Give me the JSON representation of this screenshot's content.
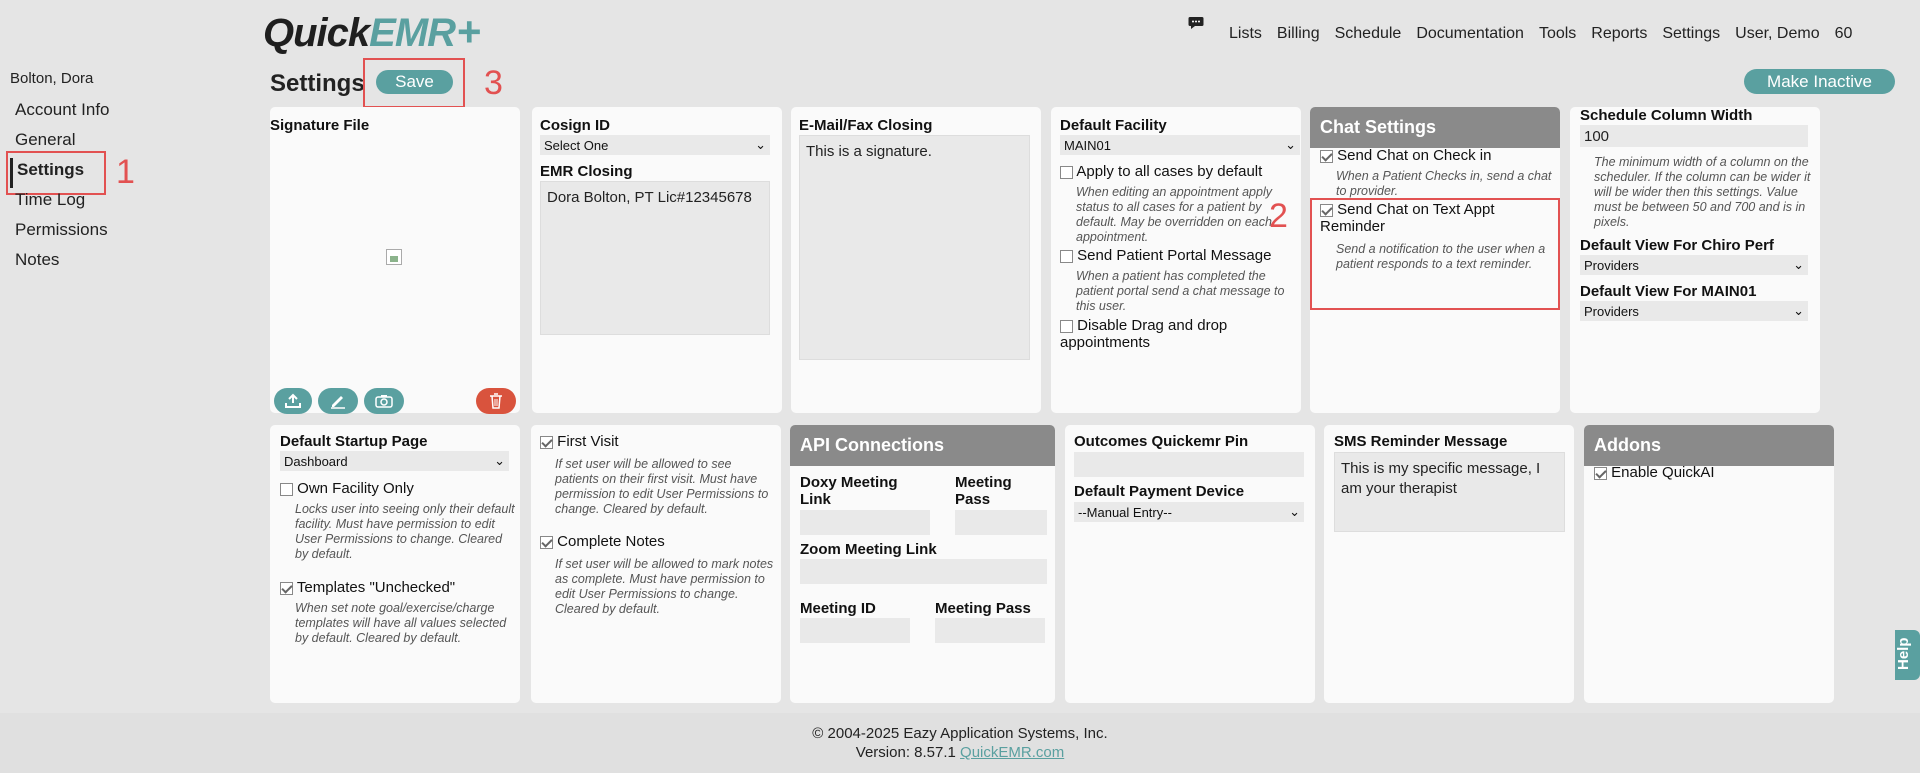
{
  "header": {
    "logo_quick": "Quick",
    "logo_emr": "EMR",
    "logo_plus": "+",
    "nav": [
      "Lists",
      "Billing",
      "Schedule",
      "Documentation",
      "Tools",
      "Reports",
      "Settings",
      "User, Demo",
      "60"
    ]
  },
  "sidebar": {
    "patient_name": "Bolton, Dora",
    "items": [
      "Account Info",
      "General",
      "Settings",
      "Time Log",
      "Permissions",
      "Notes"
    ]
  },
  "annotations": {
    "one": "1",
    "two": "2",
    "three": "3"
  },
  "page": {
    "title": "Settings",
    "save_label": "Save",
    "make_inactive_label": "Make Inactive"
  },
  "signature": {
    "label": "Signature File"
  },
  "cosign": {
    "label": "Cosign ID",
    "selected": "Select One",
    "emr_closing_label": "EMR Closing",
    "emr_closing_value": "Dora Bolton, PT Lic#12345678"
  },
  "email": {
    "label": "E-Mail/Fax Closing",
    "value": "This is a signature."
  },
  "facility": {
    "label": "Default Facility",
    "selected": "MAIN01",
    "apply_label": "Apply to all cases by default",
    "apply_note": "When editing an appointment apply status to all cases for a patient by default. May be overridden on each appointment.",
    "portal_label": "Send Patient Portal Message",
    "portal_note": "When a patient has completed the patient portal send a chat message to this user.",
    "drag_label": "Disable Drag and drop appointments"
  },
  "chat": {
    "heading": "Chat Settings",
    "checkin_label": "Send Chat on Check in",
    "checkin_note": "When a Patient Checks in, send a chat to provider.",
    "reminder_label": "Send Chat on Text Appt Reminder",
    "reminder_note": "Send a notification to the user when a patient responds to a text reminder."
  },
  "schedule": {
    "width_label": "Schedule Column Width",
    "width_value": "100",
    "width_note": "The minimum width of a column on the scheduler. If the column can be wider it will be wider then this settings. Value must be between 50 and 700 and is in pixels.",
    "chiro_label": "Default View For Chiro Perf",
    "chiro_selected": "Providers",
    "main_label": "Default View For MAIN01",
    "main_selected": "Providers"
  },
  "startup": {
    "label": "Default Startup Page",
    "selected": "Dashboard",
    "own_label": "Own Facility Only",
    "own_note": "Locks user into seeing only their default facility. Must have permission to edit User Permissions to change. Cleared by default.",
    "templates_label": "Templates \"Unchecked\"",
    "templates_note": "When set note goal/exercise/charge templates will have all values selected by default. Cleared by default."
  },
  "visit": {
    "first_label": "First Visit",
    "first_note": "If set user will be allowed to see patients on their first visit. Must have permission to edit User Permissions to change. Cleared by default.",
    "complete_label": "Complete Notes",
    "complete_note": "If set user will be allowed to mark notes as complete. Must have permission to edit User Permissions to change. Cleared by default."
  },
  "api": {
    "heading": "API Connections",
    "doxy_label": "Doxy Meeting Link",
    "meeting_pass_label": "Meeting Pass",
    "zoom_label": "Zoom Meeting Link",
    "meeting_id_label": "Meeting ID",
    "meeting_pass2_label": "Meeting Pass"
  },
  "outcomes": {
    "pin_label": "Outcomes Quickemr Pin",
    "payment_label": "Default Payment Device",
    "payment_selected": "--Manual Entry--"
  },
  "sms": {
    "label": "SMS Reminder Message",
    "value": "This is my specific message, I am your therapist"
  },
  "addons": {
    "heading": "Addons",
    "quickai_label": "Enable QuickAI"
  },
  "footer": {
    "copyright": "© 2004-2025 Eazy Application Systems, Inc.",
    "version": "Version: 8.57.1",
    "link": "QuickEMR.com"
  },
  "help": {
    "label": "Help"
  },
  "colors": {
    "accent": "#5aa0a0",
    "highlight": "#e25151",
    "delete": "#d9533d",
    "card_head": "#8a8a8a"
  }
}
